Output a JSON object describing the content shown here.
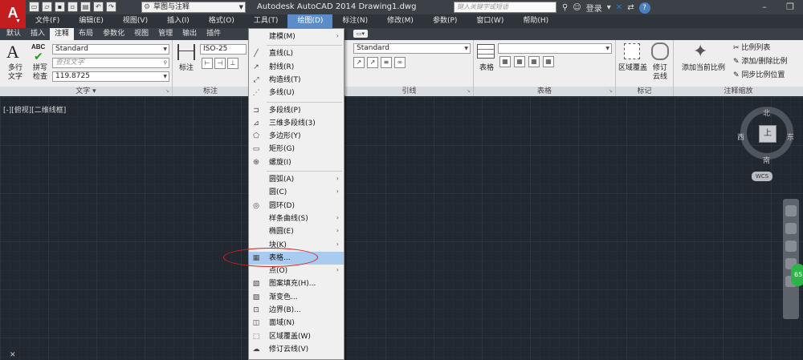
{
  "app": {
    "logo": "A",
    "title": "Autodesk AutoCAD 2014    Drawing1.dwg",
    "workspace": "草图与注释",
    "search_placeholder": "键入关键字或短语",
    "login": "登录",
    "help": "?"
  },
  "menubar": [
    "文件(F)",
    "编辑(E)",
    "视图(V)",
    "插入(I)",
    "格式(O)",
    "工具(T)",
    "绘图(D)",
    "标注(N)",
    "修改(M)",
    "参数(P)",
    "窗口(W)",
    "帮助(H)"
  ],
  "active_menu": "绘图(D)",
  "tabs": [
    "默认",
    "插入",
    "注释",
    "布局",
    "参数化",
    "视图",
    "管理",
    "输出",
    "插件"
  ],
  "active_tab": "注释",
  "ribbon": {
    "text_panel": {
      "multiline_label_1": "多行",
      "multiline_label_2": "文字",
      "abc": "ABC",
      "spell_label_1": "拼写",
      "spell_label_2": "检查",
      "style": "Standard",
      "find_placeholder": "查找文字",
      "height": "119.8725",
      "footer": "文字"
    },
    "dim_panel": {
      "dim_label": "标注",
      "style": "ISO-25",
      "footer": "标注"
    },
    "leader_panel": {
      "style": "Standard",
      "footer": "引线"
    },
    "table_panel": {
      "table_label": "表格",
      "footer": "表格"
    },
    "markup_panel": {
      "wipeout_1": "区域覆盖",
      "revcloud_1": "修订",
      "revcloud_2": "云线",
      "footer": "标记"
    },
    "scale_panel": {
      "add_current": "添加当前比例",
      "scale_list": "比例列表",
      "add_remove": "添加/删除比例",
      "sync": "同步比例位置",
      "footer": "注释缩放"
    }
  },
  "viewport": {
    "label": "[-][俯视][二维线框]",
    "north": "北",
    "south": "南",
    "east": "东",
    "west": "西",
    "face": "上",
    "wcs": "WCS",
    "badge": "65"
  },
  "draw_menu": [
    {
      "label": "建模(M)",
      "icon": "",
      "submenu": true
    },
    {
      "sep": true
    },
    {
      "label": "直线(L)",
      "icon": "line-icon"
    },
    {
      "label": "射线(R)",
      "icon": "ray-icon"
    },
    {
      "label": "构造线(T)",
      "icon": "xline-icon"
    },
    {
      "label": "多线(U)",
      "icon": "mline-icon"
    },
    {
      "sep": true
    },
    {
      "label": "多段线(P)",
      "icon": "polyline-icon"
    },
    {
      "label": "三维多段线(3)",
      "icon": "3dpoly-icon"
    },
    {
      "label": "多边形(Y)",
      "icon": "polygon-icon"
    },
    {
      "label": "矩形(G)",
      "icon": "rectangle-icon"
    },
    {
      "label": "螺旋(I)",
      "icon": "helix-icon"
    },
    {
      "sep": true
    },
    {
      "label": "圆弧(A)",
      "icon": "",
      "submenu": true
    },
    {
      "label": "圆(C)",
      "icon": "",
      "submenu": true
    },
    {
      "label": "圆环(D)",
      "icon": "donut-icon"
    },
    {
      "label": "样条曲线(S)",
      "icon": "",
      "submenu": true
    },
    {
      "label": "椭圆(E)",
      "icon": "",
      "submenu": true
    },
    {
      "label": "块(K)",
      "icon": "",
      "submenu": true
    },
    {
      "label": "表格...",
      "icon": "table-icon",
      "highlight": true
    },
    {
      "label": "点(O)",
      "icon": "",
      "submenu": true
    },
    {
      "label": "图案填充(H)...",
      "icon": "hatch-icon"
    },
    {
      "label": "渐变色...",
      "icon": "gradient-icon"
    },
    {
      "label": "边界(B)...",
      "icon": "boundary-icon"
    },
    {
      "label": "面域(N)",
      "icon": "region-icon"
    },
    {
      "label": "区域覆盖(W)",
      "icon": "wipeout-icon"
    },
    {
      "label": "修订云线(V)",
      "icon": "revcloud-icon"
    }
  ]
}
